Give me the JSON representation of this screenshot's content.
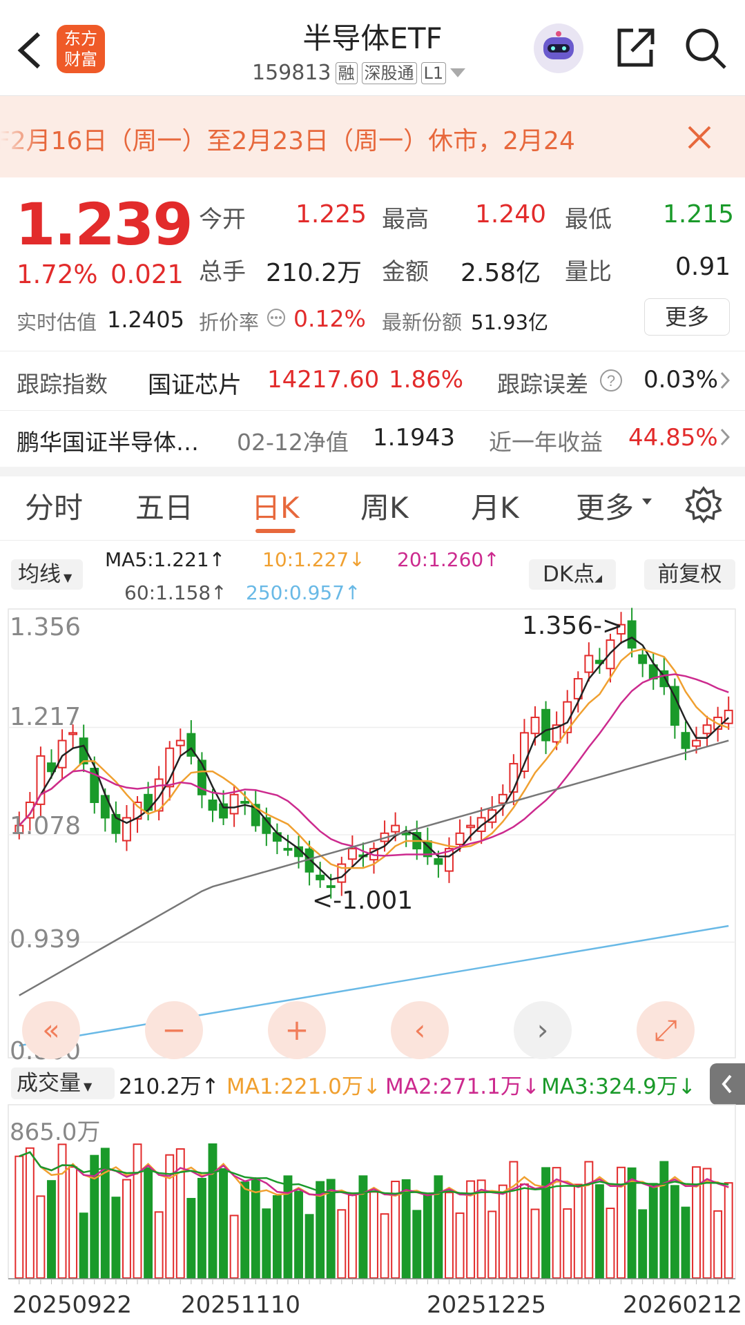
{
  "header": {
    "back_icon": "chevron-left-icon",
    "logo_line1": "东方",
    "logo_line2": "财富",
    "title": "半导体ETF",
    "code": "159813",
    "tags": [
      "融",
      "深股通",
      "L1"
    ],
    "robot_icon": "robot-avatar-icon",
    "share_icon": "share-icon",
    "search_icon": "search-icon"
  },
  "notice": {
    "text": "F2月16日（周一）至2月23日（周一）休市，2月24",
    "close_icon": "close-icon"
  },
  "quote": {
    "price": "1.239",
    "change_pct": "1.72%",
    "change": "0.021",
    "open_label": "今开",
    "open": "1.225",
    "high_label": "最高",
    "high": "1.240",
    "low_label": "最低",
    "low": "1.215",
    "volume_label": "总手",
    "volume": "210.2万",
    "amount_label": "金额",
    "amount": "2.58亿",
    "ratio_label": "量比",
    "ratio": "0.91",
    "iopv_label": "实时估值",
    "iopv": "1.2405",
    "discount_label": "折价率",
    "discount": "0.12%",
    "shares_label": "最新份额",
    "shares": "51.93亿",
    "more_button": "更多"
  },
  "index_row": {
    "label": "跟踪指数",
    "index_name": "国证芯片",
    "index_value": "14217.60",
    "index_pct": "1.86%",
    "err_label": "跟踪误差",
    "err_value": "0.03%"
  },
  "fund_row": {
    "name": "鹏华国证半导体…",
    "nav_label": "02-12净值",
    "nav": "1.1943",
    "ret_label": "近一年收益",
    "ret": "44.85%"
  },
  "tabs": [
    "分时",
    "五日",
    "日K",
    "周K",
    "月K",
    "更多"
  ],
  "active_tab": 2,
  "ma_bar": {
    "dropdown": "均线",
    "ma5": "MA5:1.221↑",
    "ma10": "10:1.227↓",
    "ma20": "20:1.260↑",
    "ma60": "60:1.158↑",
    "ma250": "250:0.957↑",
    "dk_button": "DK点",
    "fq_button": "前复权"
  },
  "colors": {
    "red": "#e22b2b",
    "green": "#1a9a2a",
    "ma5": "#222222",
    "ma10": "#f0a030",
    "ma20": "#cc2a8e",
    "ma60": "#777777",
    "ma250": "#69b9e6",
    "accent": "#e7683c"
  },
  "chart_data": [
    {
      "type": "candlestick",
      "title": "",
      "y_ticks": [
        "1.356",
        "1.217",
        "1.078",
        "0.939",
        "0.800"
      ],
      "ylim": [
        0.8,
        1.356
      ],
      "annotations": [
        "1.356->",
        "<-1.001"
      ],
      "ma_series": [
        "MA5",
        "MA10",
        "MA20",
        "MA60",
        "MA250"
      ]
    },
    {
      "type": "bar",
      "title": "",
      "y_tick": "865.0万",
      "x_ticks": [
        "20250922",
        "20251110",
        "20251225",
        "20260212"
      ],
      "vol_label": "210.2万↑",
      "ma1": "MA1:221.0万↓",
      "ma2": "MA2:271.1万↓",
      "ma3": "MA3:324.9万↓",
      "dropdown": "成交量"
    }
  ],
  "controls": [
    "«",
    "−",
    "+",
    "‹",
    "›",
    "⤢"
  ]
}
